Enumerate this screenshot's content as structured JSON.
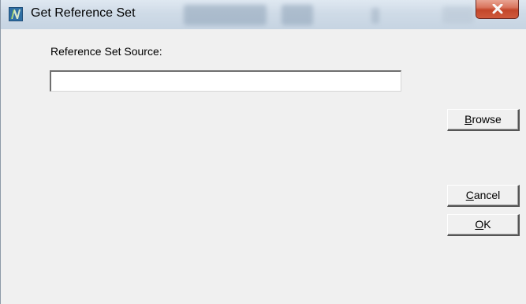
{
  "window": {
    "title": "Get Reference Set"
  },
  "form": {
    "source_label": "Reference Set Source:",
    "source_value": "",
    "source_placeholder": ""
  },
  "buttons": {
    "browse": {
      "mnemonic": "B",
      "rest": "rowse"
    },
    "cancel": {
      "mnemonic": "C",
      "rest": "ancel"
    },
    "ok": {
      "mnemonic": "O",
      "rest": "K"
    }
  },
  "icons": {
    "app": "app-logo-icon",
    "close": "close-icon"
  },
  "colors": {
    "dialog_bg": "#f0f0f0",
    "close_button": "#c3462a",
    "titlebar": "#cfdbe7"
  }
}
